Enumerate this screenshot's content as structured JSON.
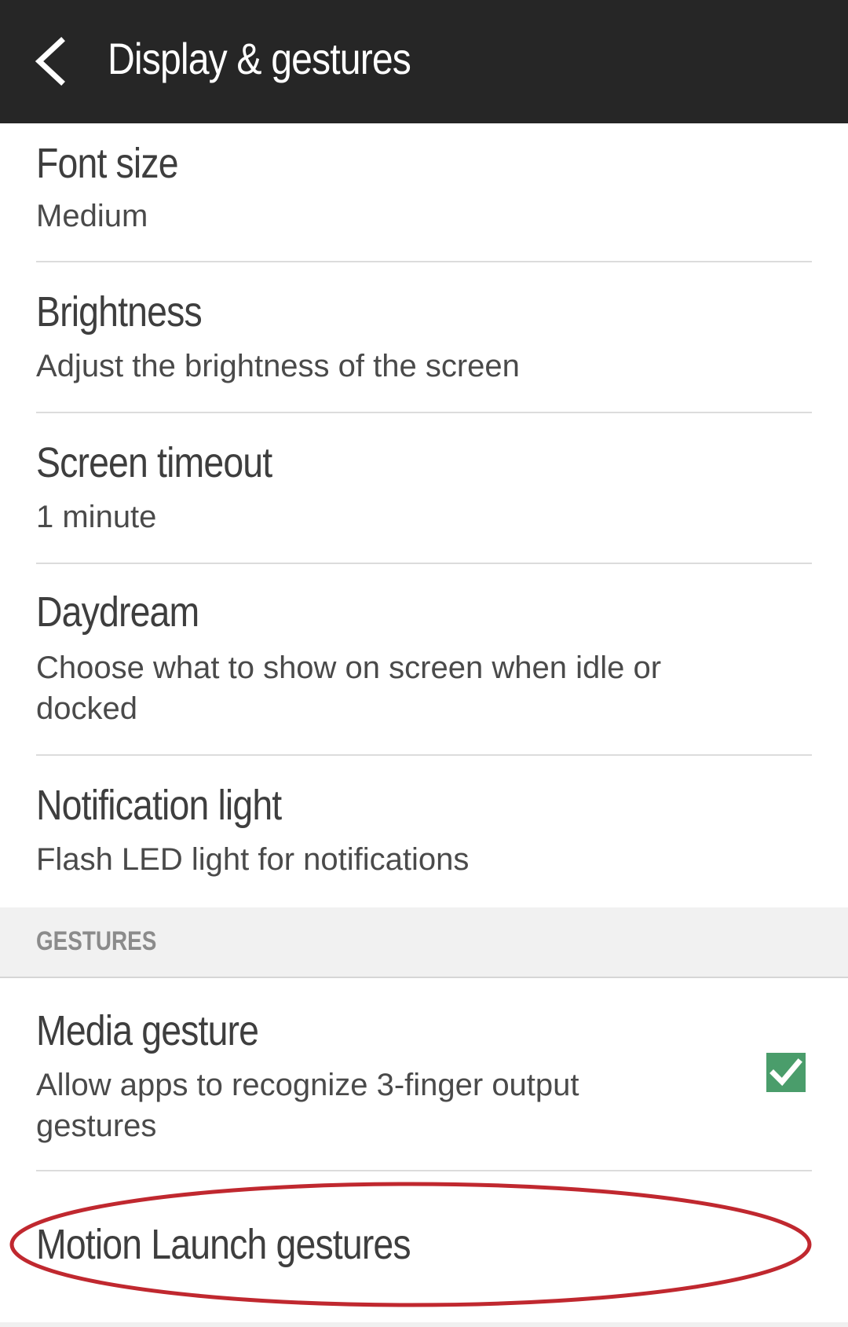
{
  "header": {
    "back_icon": "chevron-left-icon",
    "title": "Display & gestures"
  },
  "settings": [
    {
      "title": "Font size",
      "subtitle": "Medium"
    },
    {
      "title": "Brightness",
      "subtitle": "Adjust the brightness of the screen"
    },
    {
      "title": "Screen timeout",
      "subtitle": "1 minute"
    },
    {
      "title": "Daydream",
      "subtitle_line1": "Choose what to show on screen when idle or",
      "subtitle_line2": "docked"
    },
    {
      "title": "Notification light",
      "subtitle": "Flash LED light for notifications"
    }
  ],
  "gestures_section": {
    "label": "GESTURES",
    "items": [
      {
        "title": "Media gesture",
        "subtitle_line1": "Allow apps to recognize 3-finger output",
        "subtitle_line2": "gestures",
        "checked": true,
        "check_icon": "checkmark-icon",
        "check_color": "#4a9d6b"
      },
      {
        "title": "Motion Launch gestures",
        "annotation": "red-ellipse-highlight",
        "annotation_color": "#c0282f"
      }
    ]
  }
}
